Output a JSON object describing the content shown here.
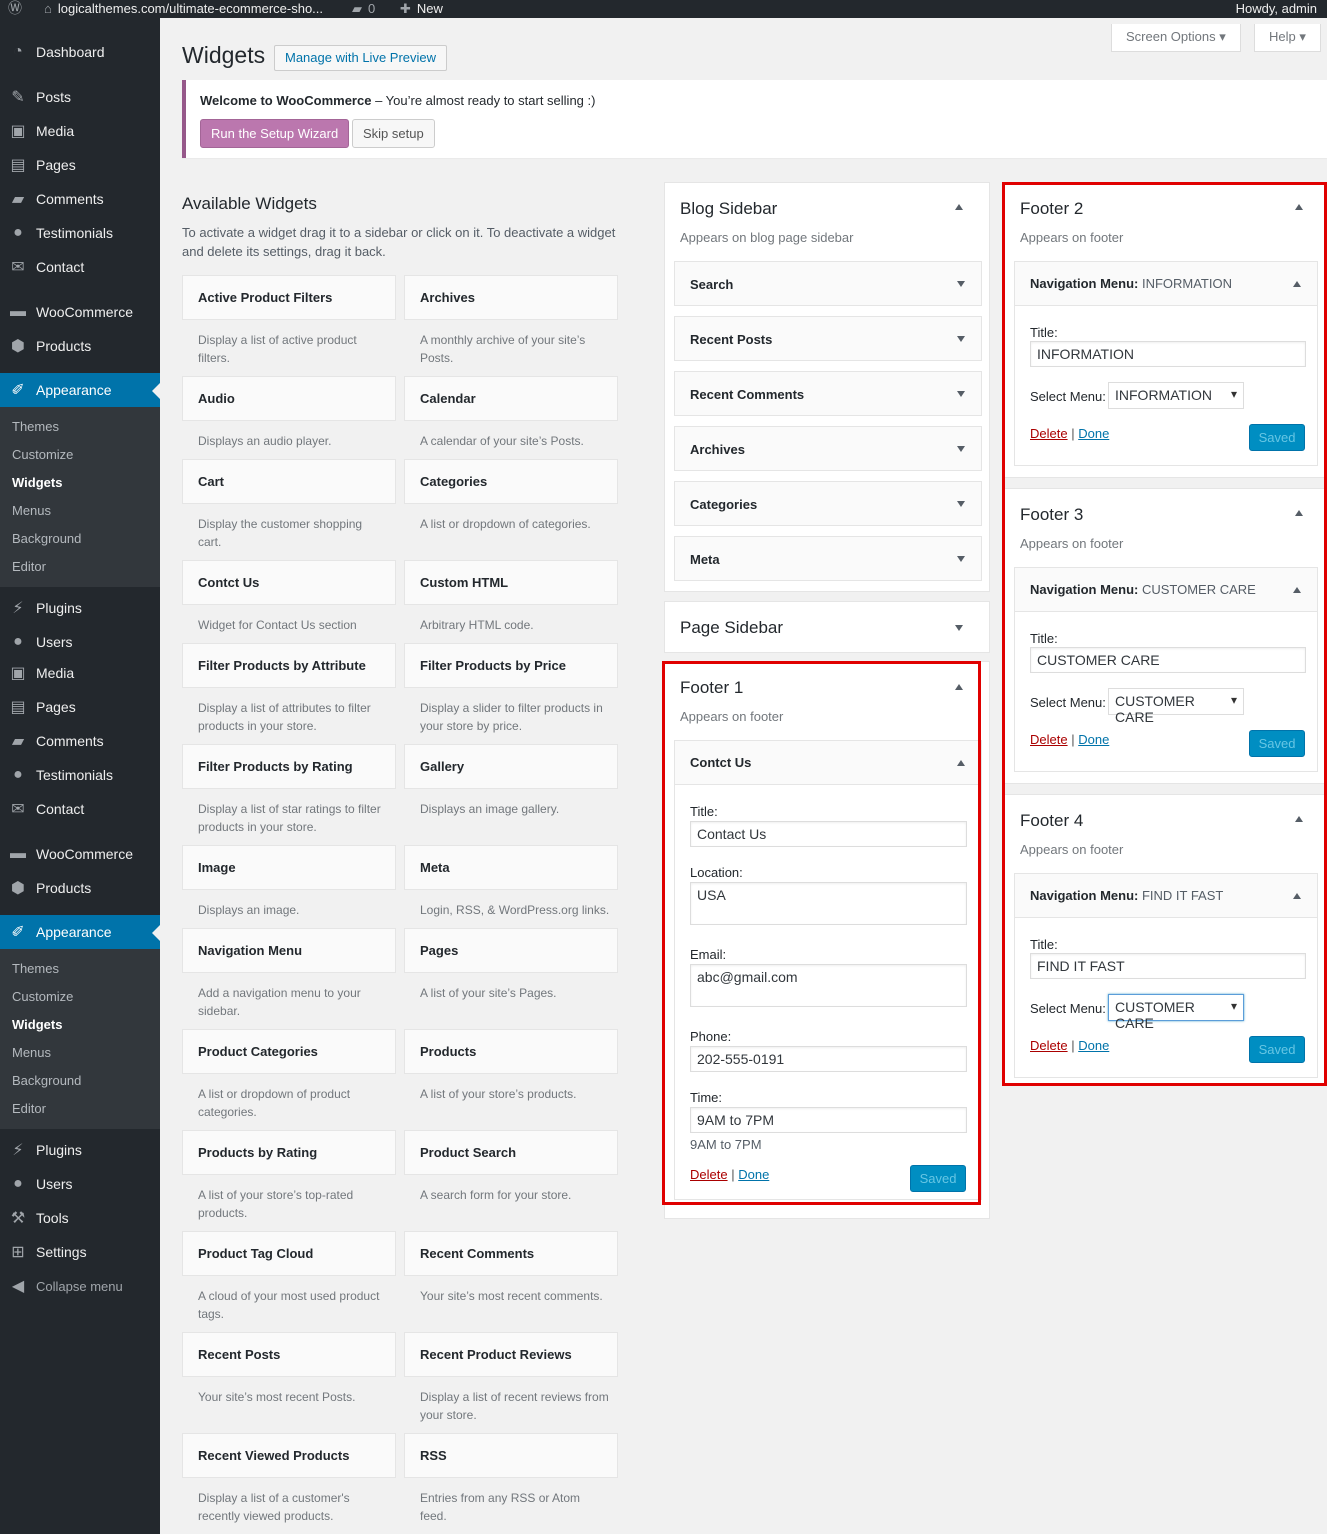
{
  "adminbar": {
    "site_url": "logicalthemes.com/ultimate-ecommerce-sho...",
    "comments_count": "0",
    "new_label": "New",
    "howdy": "Howdy, admin"
  },
  "menu": {
    "dashboard": "Dashboard",
    "posts": "Posts",
    "media": "Media",
    "pages": "Pages",
    "comments": "Comments",
    "testimonials": "Testimonials",
    "contact": "Contact",
    "woocommerce": "WooCommerce",
    "products": "Products",
    "appearance": "Appearance",
    "sub": [
      "Themes",
      "Customize",
      "Widgets",
      "Menus",
      "Background",
      "Editor"
    ],
    "plugins": "Plugins",
    "users": "Users",
    "tools": "Tools",
    "settings": "Settings",
    "collapse": "Collapse menu"
  },
  "header": {
    "title": "Widgets",
    "live_preview": "Manage with Live Preview",
    "screen_options": "Screen Options",
    "help": "Help"
  },
  "notice": {
    "bold": "Welcome to WooCommerce",
    "rest": " – You’re almost ready to start selling :)",
    "run_wizard": "Run the Setup Wizard",
    "skip": "Skip setup"
  },
  "available": {
    "title": "Available Widgets",
    "description": "To activate a widget drag it to a sidebar or click on it. To deactivate a widget and delete its settings, drag it back.",
    "widgets": [
      {
        "name": "Active Product Filters",
        "desc": "Display a list of active product filters."
      },
      {
        "name": "Archives",
        "desc": "A monthly archive of your site’s Posts."
      },
      {
        "name": "Audio",
        "desc": "Displays an audio player."
      },
      {
        "name": "Calendar",
        "desc": "A calendar of your site’s Posts."
      },
      {
        "name": "Cart",
        "desc": "Display the customer shopping cart."
      },
      {
        "name": "Categories",
        "desc": "A list or dropdown of categories."
      },
      {
        "name": "Contct Us",
        "desc": "Widget for Contact Us section"
      },
      {
        "name": "Custom HTML",
        "desc": "Arbitrary HTML code."
      },
      {
        "name": "Filter Products by Attribute",
        "desc": "Display a list of attributes to filter products in your store."
      },
      {
        "name": "Filter Products by Price",
        "desc": "Display a slider to filter products in your store by price."
      },
      {
        "name": "Filter Products by Rating",
        "desc": "Display a list of star ratings to filter products in your store."
      },
      {
        "name": "Gallery",
        "desc": "Displays an image gallery."
      },
      {
        "name": "Image",
        "desc": "Displays an image."
      },
      {
        "name": "Meta",
        "desc": "Login, RSS, & WordPress.org links."
      },
      {
        "name": "Navigation Menu",
        "desc": "Add a navigation menu to your sidebar."
      },
      {
        "name": "Pages",
        "desc": "A list of your site’s Pages."
      },
      {
        "name": "Product Categories",
        "desc": "A list or dropdown of product categories."
      },
      {
        "name": "Products",
        "desc": "A list of your store’s products."
      },
      {
        "name": "Products by Rating",
        "desc": "A list of your store’s top-rated products."
      },
      {
        "name": "Product Search",
        "desc": "A search form for your store."
      },
      {
        "name": "Product Tag Cloud",
        "desc": "A cloud of your most used product tags."
      },
      {
        "name": "Recent Comments",
        "desc": "Your site’s most recent comments."
      },
      {
        "name": "Recent Posts",
        "desc": "Your site’s most recent Posts."
      },
      {
        "name": "Recent Product Reviews",
        "desc": "Display a list of recent reviews from your store."
      },
      {
        "name": "Recent Viewed Products",
        "desc": "Display a list of a customer's recently viewed products."
      },
      {
        "name": "RSS",
        "desc": "Entries from any RSS or Atom feed."
      }
    ]
  },
  "blog_sidebar": {
    "title": "Blog Sidebar",
    "desc": "Appears on blog page sidebar",
    "widgets": [
      "Search",
      "Recent Posts",
      "Recent Comments",
      "Archives",
      "Categories",
      "Meta"
    ]
  },
  "page_sidebar": {
    "title": "Page Sidebar"
  },
  "footer1": {
    "title": "Footer 1",
    "desc": "Appears on footer",
    "widget_title": "Contct Us",
    "title_label": "Title:",
    "title_value": "Contact Us",
    "location_label": "Location:",
    "location_value": "USA",
    "email_label": "Email:",
    "email_value": "abc@gmail.com",
    "phone_label": "Phone:",
    "phone_value": "202-555-0191",
    "time_label": "Time:",
    "time_value": "9AM to 7PM",
    "time_hint": "9AM to 7PM",
    "delete": "Delete",
    "sep": "|",
    "done": "Done",
    "saved": "Saved"
  },
  "footer2": {
    "title": "Footer 2",
    "desc": "Appears on footer",
    "widget_prefix": "Navigation Menu:",
    "widget_suffix": " INFORMATION",
    "title_label": "Title:",
    "title_value": "INFORMATION",
    "menu_label": "Select Menu:",
    "menu_value": "INFORMATION",
    "delete": "Delete",
    "sep": "|",
    "done": "Done",
    "saved": "Saved"
  },
  "footer3": {
    "title": "Footer 3",
    "desc": "Appears on footer",
    "widget_prefix": "Navigation Menu:",
    "widget_suffix": " CUSTOMER CARE",
    "title_label": "Title:",
    "title_value": "CUSTOMER CARE",
    "menu_label": "Select Menu:",
    "menu_value": "CUSTOMER CARE",
    "delete": "Delete",
    "sep": "|",
    "done": "Done",
    "saved": "Saved"
  },
  "footer4": {
    "title": "Footer 4",
    "desc": "Appears on footer",
    "widget_prefix": "Navigation Menu:",
    "widget_suffix": " FIND IT FAST",
    "title_label": "Title:",
    "title_value": "FIND IT FAST",
    "menu_label": "Select Menu:",
    "menu_value": "CUSTOMER CARE",
    "delete": "Delete",
    "sep": "|",
    "done": "Done",
    "saved": "Saved"
  }
}
